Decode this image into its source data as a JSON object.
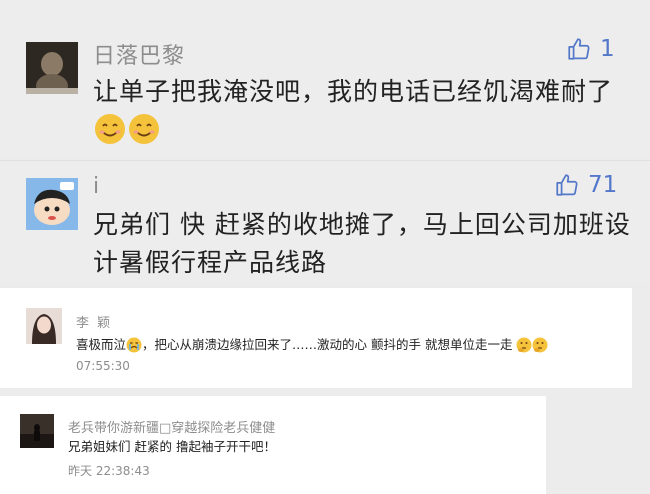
{
  "comments": [
    {
      "author": "日落巴黎",
      "text": "让单子把我淹没吧，我的电话已经饥渴难耐了",
      "emojis": [
        "smiling-face-emoji",
        "smiling-face-emoji"
      ],
      "likes": "1"
    },
    {
      "author": "i",
      "text": "兄弟们 快 赶紧的收地摊了，马上回公司加班设计暑假行程产品线路",
      "likes": "71"
    },
    {
      "author": "李 颖",
      "text": "喜极而泣",
      "text2": "，把心从崩溃边缘拉回来了……激动的心 颤抖的手 就想单位走一走",
      "emojis": [
        "crying-face-emoji",
        "thinking-face-emoji",
        "thinking-face-emoji"
      ],
      "time": "07:55:30"
    },
    {
      "author": "老兵带你游新疆□穿越探险老兵健健",
      "text": "兄弟姐妹们 赶紧的 撸起袖子开干吧！",
      "time": "昨天 22:38:43"
    }
  ],
  "colors": {
    "like": "#5377c9",
    "name": "#8d8d8d",
    "text": "#222222",
    "emoji": "#f5c33b"
  },
  "icons": [
    "thumbs-up-icon"
  ]
}
